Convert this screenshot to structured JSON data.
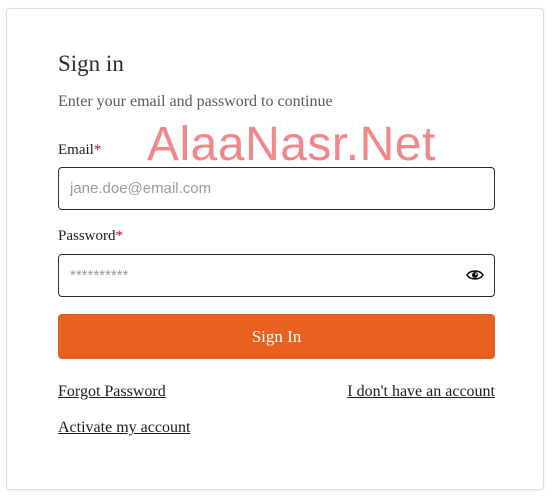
{
  "signin": {
    "title": "Sign in",
    "subtitle": "Enter your email and password to continue",
    "watermark": "AlaaNasr.Net",
    "email": {
      "label": "Email",
      "required_mark": "*",
      "placeholder": "jane.doe@email.com"
    },
    "password": {
      "label": "Password",
      "required_mark": "*",
      "placeholder": "**********"
    },
    "submit_label": "Sign In",
    "links": {
      "forgot": "Forgot Password",
      "no_account": "I don't have an account",
      "activate": "Activate my account"
    }
  },
  "colors": {
    "accent": "#e8611f",
    "input_border": "#1f2f45",
    "required": "#b5151b",
    "watermark": "#f2868a"
  },
  "icons": {
    "password_toggle": "eye-icon"
  }
}
